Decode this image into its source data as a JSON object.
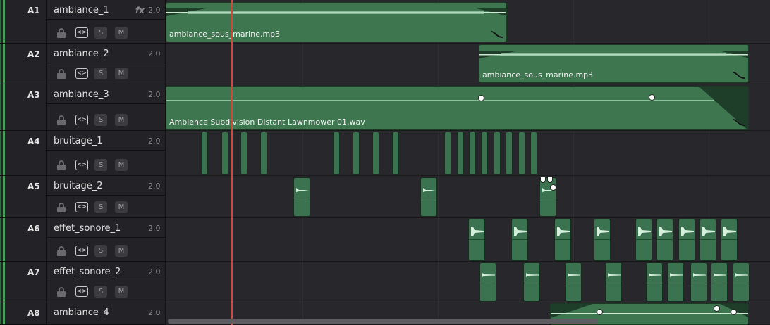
{
  "tracks": [
    {
      "id": "A1",
      "name": "ambiance_1",
      "fx": "fx",
      "volume": "2.0",
      "lock": "lock-icon",
      "link": "<>",
      "solo": "S",
      "mute": "M"
    },
    {
      "id": "A2",
      "name": "ambiance_2",
      "fx": "",
      "volume": "2.0",
      "lock": "lock-icon",
      "link": "<>",
      "solo": "S",
      "mute": "M"
    },
    {
      "id": "A3",
      "name": "ambiance_3",
      "fx": "",
      "volume": "2.0",
      "lock": "lock-icon",
      "link": "<>",
      "solo": "S",
      "mute": "M"
    },
    {
      "id": "A4",
      "name": "bruitage_1",
      "fx": "",
      "volume": "2.0",
      "lock": "lock-icon",
      "link": "<>",
      "solo": "S",
      "mute": "M"
    },
    {
      "id": "A5",
      "name": "bruitage_2",
      "fx": "",
      "volume": "2.0",
      "lock": "lock-icon",
      "link": "<>",
      "solo": "S",
      "mute": "M"
    },
    {
      "id": "A6",
      "name": "effet_sonore_1",
      "fx": "",
      "volume": "2.0",
      "lock": "lock-icon",
      "link": "<>",
      "solo": "S",
      "mute": "M"
    },
    {
      "id": "A7",
      "name": "effet_sonore_2",
      "fx": "",
      "volume": "2.0",
      "lock": "lock-icon",
      "link": "<>",
      "solo": "S",
      "mute": "M"
    },
    {
      "id": "A8",
      "name": "ambiance_4",
      "fx": "",
      "volume": "2.0",
      "lock": "lock-icon",
      "link": "<>",
      "solo": "S",
      "mute": "M"
    }
  ],
  "clips": {
    "a1": {
      "name": "ambiance_sous_marine.mp3"
    },
    "a2": {
      "name": "ambiance_sous_marine.mp3"
    },
    "a3": {
      "name": "Ambience Subdivision Distant Lawnmower 01.wav"
    }
  },
  "colors": {
    "clip": "#3e7650",
    "track_color": "#47a35c",
    "playhead": "#d0483d",
    "background": "#28282c"
  }
}
